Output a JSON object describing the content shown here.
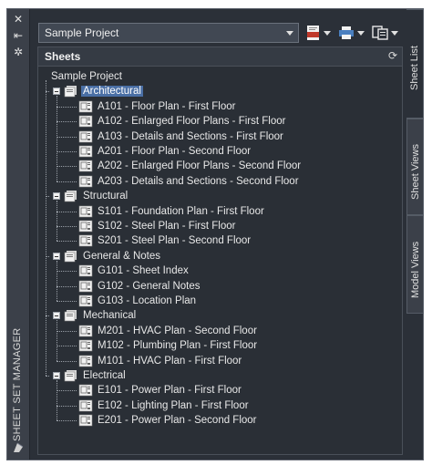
{
  "palette": {
    "title": "SHEET SET MANAGER",
    "controls": {
      "close_glyph": "✕",
      "autohide_glyph": "⇤",
      "properties_glyph": "✲"
    }
  },
  "toolbar": {
    "project_value": "Sample Project"
  },
  "panel": {
    "title": "Sheets"
  },
  "tabs": [
    {
      "label": "Sheet List",
      "active": true
    },
    {
      "label": "Sheet Views",
      "active": false
    },
    {
      "label": "Model Views",
      "active": false
    }
  ],
  "tree": {
    "root": "Sample Project",
    "groups": [
      {
        "label": "Architectural",
        "selected": true,
        "sheets": [
          "A101 - Floor Plan - First Floor",
          "A102 - Enlarged Floor Plans - First Floor",
          "A103 - Details and Sections - First Floor",
          "A201 - Floor Plan - Second Floor",
          "A202 - Enlarged Floor Plans - Second Floor",
          "A203 - Details and Sections - Second Floor"
        ]
      },
      {
        "label": "Structural",
        "selected": false,
        "sheets": [
          "S101 - Foundation Plan - First Floor",
          "S102 - Steel Plan - First Floor",
          "S201 - Steel Plan - Second Floor"
        ]
      },
      {
        "label": "General & Notes",
        "selected": false,
        "sheets": [
          "G101 - Sheet Index",
          "G102 - General Notes",
          "G103 - Location Plan"
        ]
      },
      {
        "label": "Mechanical",
        "selected": false,
        "sheets": [
          "M201 - HVAC Plan - Second Floor",
          "M102 - Plumbing Plan - First Floor",
          "M101 - HVAC Plan - First Floor"
        ]
      },
      {
        "label": "Electrical",
        "selected": false,
        "sheets": [
          "E101 - Power Plan - First Floor",
          "E102 - Lighting Plan - First Floor",
          "E201 - Power Plan - Second Floor"
        ]
      }
    ]
  },
  "colors": {
    "selection": "#4a6fa5",
    "background": "#2b3038",
    "dwf_red": "#c0392b"
  }
}
